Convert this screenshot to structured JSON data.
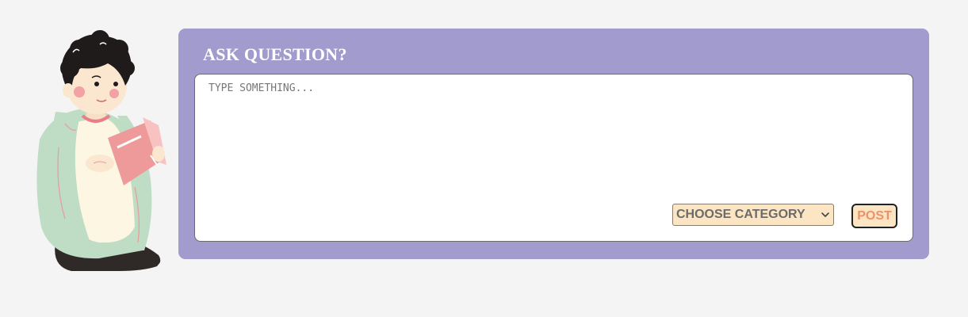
{
  "panel": {
    "title": "ASK QUESTION?",
    "background_color": "#a29bcd"
  },
  "question_input": {
    "placeholder": "TYPE SOMETHING...",
    "value": ""
  },
  "category_select": {
    "selected": "CHOOSE CATEGORY",
    "icon": "chevron-down-icon"
  },
  "post_button": {
    "label": "POST",
    "text_color": "#f0906a",
    "background_color": "#fce5c3"
  },
  "illustration": {
    "subject": "person-reading-book"
  }
}
